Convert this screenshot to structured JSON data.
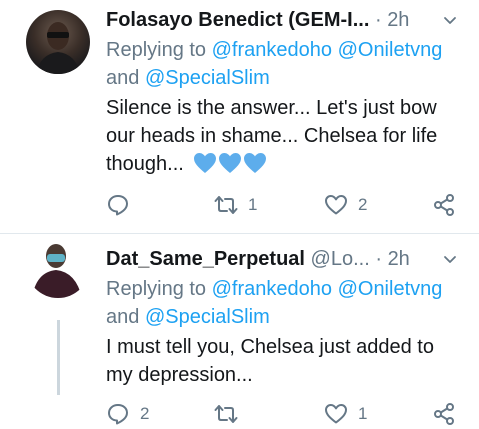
{
  "tweets": [
    {
      "name": "Folasayo Benedict (GEM-I...",
      "handle": "",
      "dot": "·",
      "time": "2h",
      "reply_prefix": "Replying to",
      "reply_user_1": "@frankedoho",
      "reply_user_2": "@Oniletvng",
      "reply_and": "and",
      "reply_user_3": "@SpecialSlim",
      "text_line_1": "Silence is the answer... Let's just bow",
      "text_line_2": "our heads in shame... Chelsea for life",
      "text_line_3": "though...",
      "emoji": "blue-heart-icon x3",
      "reply_count": "",
      "retweet_count": "1",
      "like_count": "2"
    },
    {
      "name": "Dat_Same_Perpetual",
      "handle": "@Lo...",
      "dot": "·",
      "time": "2h",
      "reply_prefix": "Replying to",
      "reply_user_1": "@frankedoho",
      "reply_user_2": "@Oniletvng",
      "reply_and": "and",
      "reply_user_3": "@SpecialSlim",
      "text_line_1": "I must tell you, Chelsea just added to",
      "text_line_2": "my depression...",
      "reply_count": "2",
      "retweet_count": "",
      "like_count": "1"
    }
  ],
  "colors": {
    "link": "#1da1f2",
    "secondary": "#657786",
    "heart_emoji": "#5DADEC"
  }
}
